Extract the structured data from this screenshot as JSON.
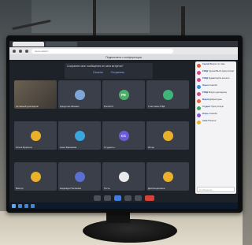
{
  "browser": {
    "url": "zoom.us/wc/..."
  },
  "app": {
    "title": "Подключено к конференции"
  },
  "prompt": {
    "question": "Сохранить все сообщения из чата встречи?",
    "actions": [
      "Отмена",
      "Сохранить"
    ]
  },
  "tiles": [
    {
      "name": "Активный докладчик",
      "initials": "",
      "color": "#6b6152",
      "video": true
    },
    {
      "name": "Кредитно-Финанс.",
      "initials": "",
      "color": "#7ea7d8",
      "video": false
    },
    {
      "name": "РоссКСУ",
      "initials": "РЕ",
      "color": "#4cae6a",
      "video": false
    },
    {
      "name": "Участники РЭД",
      "initials": "",
      "color": "#3fb57a",
      "video": false
    },
    {
      "name": "Ольга Брагина",
      "initials": "",
      "color": "#e9b12a",
      "video": false
    },
    {
      "name": "Анна Баранова",
      "initials": "",
      "color": "#3aa6e0",
      "video": false
    },
    {
      "name": "Студенты",
      "initials": "СС",
      "color": "#6c5bd6",
      "video": false
    },
    {
      "name": "Игорь",
      "initials": "",
      "color": "#e9b12a",
      "video": false
    },
    {
      "name": "Виктор",
      "initials": "",
      "color": "#e9b12a",
      "video": false
    },
    {
      "name": "Надежда Полякова",
      "initials": "",
      "color": "#5a6fd1",
      "video": false
    },
    {
      "name": "Гость",
      "initials": "",
      "color": "#eaeaea",
      "video": false
    },
    {
      "name": "Дистанционное",
      "initials": "",
      "color": "#e9b12a",
      "video": false
    }
  ],
  "chat": {
    "messages": [
      {
        "from": "Сергей",
        "text": "Вопрос по теме",
        "color": "#e05a3a"
      },
      {
        "from": "РЭКД",
        "text": "Группа ВЭ-21 присутствует",
        "color": "#d24a8a"
      },
      {
        "from": "РЭКД",
        "text": "Здравствуйте коллеги",
        "color": "#d24a8a"
      },
      {
        "from": "Ольга",
        "text": "Спасибо",
        "color": "#3a8ee0"
      },
      {
        "from": "РЭКД",
        "text": "Вопрос докладчику",
        "color": "#d24a8a"
      },
      {
        "from": "Мария",
        "text": "Добрый день",
        "color": "#e06a3a"
      },
      {
        "from": "Студент",
        "text": "Присутствую",
        "color": "#3aa65a"
      },
      {
        "from": "Игорь",
        "text": "Спасибо",
        "color": "#8a5ad2"
      },
      {
        "from": "Анна",
        "text": "Понятно",
        "color": "#e0b03a"
      }
    ],
    "input_placeholder": "Сообщение..."
  }
}
